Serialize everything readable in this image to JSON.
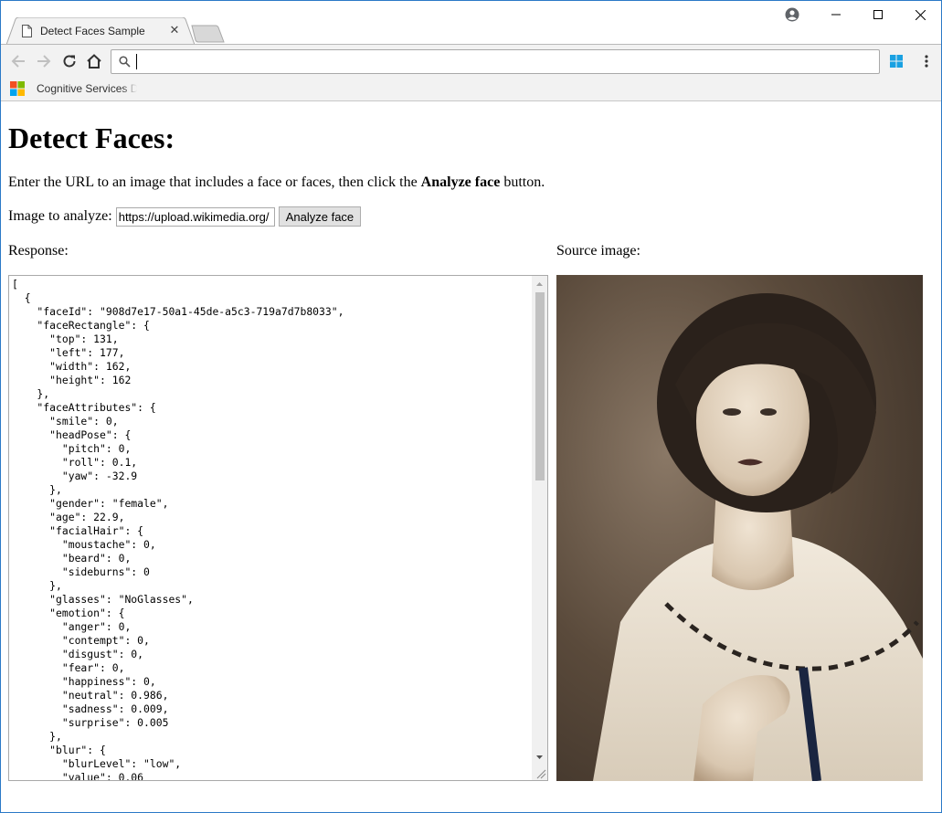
{
  "browser": {
    "tab_title": "Detect Faces Sample",
    "address_value": "",
    "bookmark_label": "Cognitive Services Demo"
  },
  "page": {
    "heading": "Detect Faces:",
    "intro_before": "Enter the URL to an image that includes a face or faces, then click the ",
    "intro_bold": "Analyze face",
    "intro_after": " button.",
    "analyze_label": "Image to analyze:",
    "url_value": "https://upload.wikimedia.org/",
    "analyze_button": "Analyze face",
    "response_label": "Response:",
    "source_label": "Source image:",
    "response_text": "[\n  {\n    \"faceId\": \"908d7e17-50a1-45de-a5c3-719a7d7b8033\",\n    \"faceRectangle\": {\n      \"top\": 131,\n      \"left\": 177,\n      \"width\": 162,\n      \"height\": 162\n    },\n    \"faceAttributes\": {\n      \"smile\": 0,\n      \"headPose\": {\n        \"pitch\": 0,\n        \"roll\": 0.1,\n        \"yaw\": -32.9\n      },\n      \"gender\": \"female\",\n      \"age\": 22.9,\n      \"facialHair\": {\n        \"moustache\": 0,\n        \"beard\": 0,\n        \"sideburns\": 0\n      },\n      \"glasses\": \"NoGlasses\",\n      \"emotion\": {\n        \"anger\": 0,\n        \"contempt\": 0,\n        \"disgust\": 0,\n        \"fear\": 0,\n        \"happiness\": 0,\n        \"neutral\": 0.986,\n        \"sadness\": 0.009,\n        \"surprise\": 0.005\n      },\n      \"blur\": {\n        \"blurLevel\": \"low\",\n        \"value\": 0.06"
  },
  "colors": {
    "window_border": "#2b79c7",
    "toolbar_bg": "#f2f2f2",
    "windows_logo": "#1aa1e2"
  }
}
